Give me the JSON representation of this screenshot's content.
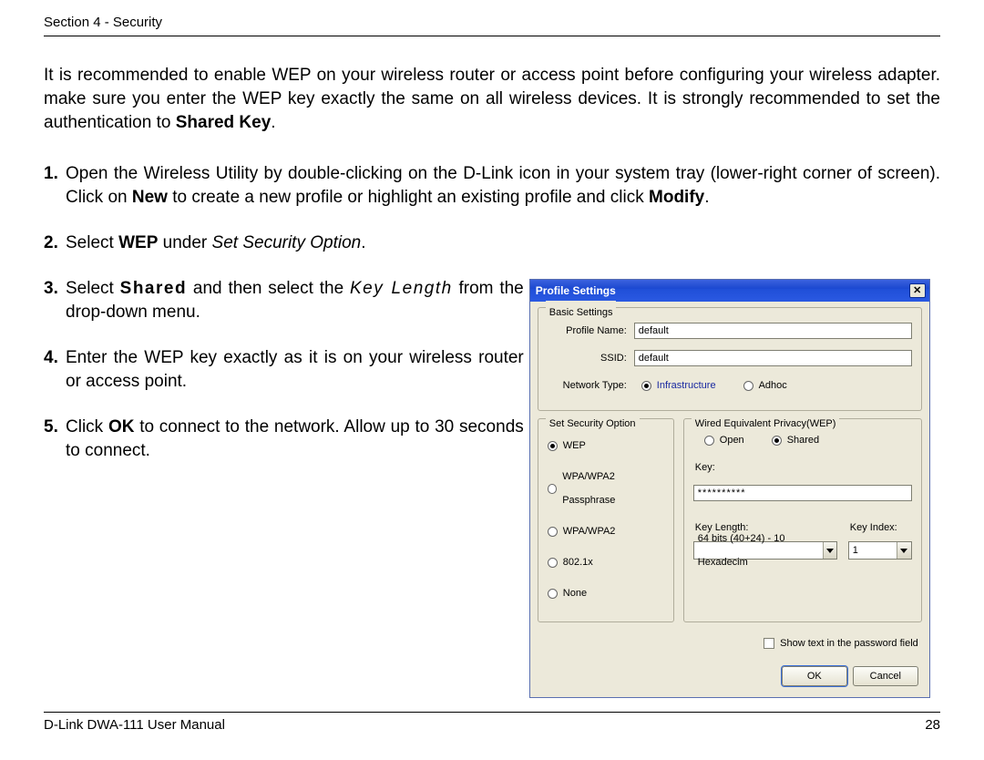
{
  "header": {
    "section_label": "Section 4 - Security"
  },
  "intro": {
    "before_bold": "It is recommended to enable WEP on your wireless router or access point before configuring your wireless adapter. make sure you enter the WEP key exactly the same on all wireless devices. It is strongly recommended to set the authentication to ",
    "bold": "Shared Key",
    "after_bold": "."
  },
  "steps": {
    "s1": {
      "num": "1.",
      "t1": " Open the Wireless Utility by double-clicking on the D-Link icon in your system tray (lower-right corner of screen). Click on ",
      "bNew": "New",
      "t2": " to create a new profile or highlight an existing profile and click ",
      "bModify": "Modify",
      "t3": "."
    },
    "s2": {
      "num": "2.",
      "t1": " Select ",
      "bWEP": "WEP",
      "t2": " under ",
      "iOpt": "Set Security Option",
      "t3": "."
    },
    "s3": {
      "num": "3.",
      "t1": " Select ",
      "bShared": "Shared",
      "t2": " and then select the ",
      "iKL": "Key Length",
      "t3": " from the drop-down menu."
    },
    "s4": {
      "num": "4.",
      "t1": " Enter the WEP key exactly as it is on your wireless router or access point."
    },
    "s5": {
      "num": "5.",
      "t1": " Click ",
      "bOK": "OK",
      "t2": " to connect to the network. Allow up to 30 seconds to connect."
    }
  },
  "dialog": {
    "title": "Profile Settings",
    "basic": {
      "legend": "Basic Settings",
      "profile_name_label": "Profile Name:",
      "profile_name_value": "default",
      "ssid_label": "SSID:",
      "ssid_value": "default",
      "network_type_label": "Network Type:",
      "infra": "Infrastructure",
      "adhoc": "Adhoc"
    },
    "security": {
      "legend": "Set Security Option",
      "options": {
        "wep": "WEP",
        "wpapp": "WPA/WPA2 Passphrase",
        "wpa": "WPA/WPA2",
        "dot1x": "802.1x",
        "none": "None"
      }
    },
    "wep": {
      "legend": "Wired Equivalent Privacy(WEP)",
      "open": "Open",
      "shared": "Shared",
      "key_label": "Key:",
      "key_value": "**********",
      "key_length_label": "Key Length:",
      "key_length_value": "64 bits (40+24) - 10 Hexadecim",
      "key_index_label": "Key Index:",
      "key_index_value": "1"
    },
    "show_text": "Show text in the password field",
    "ok": "OK",
    "cancel": "Cancel"
  },
  "footer": {
    "manual": "D-Link DWA-111 User Manual",
    "page": "28"
  }
}
